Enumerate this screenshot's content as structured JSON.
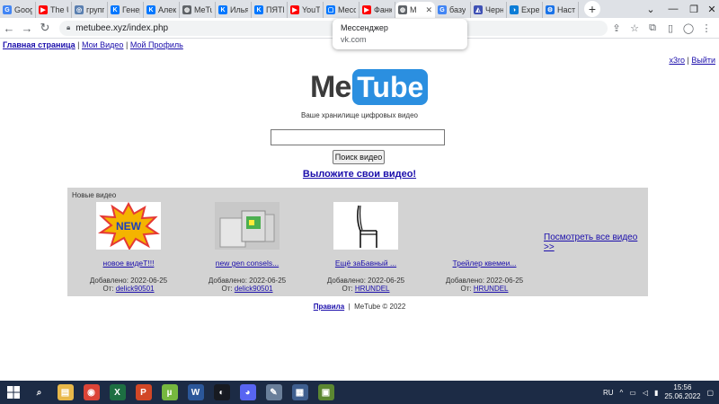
{
  "browser": {
    "tabs": [
      {
        "label": "Goog",
        "icon": "google-icon",
        "color": "#4285f4",
        "glyph": "G"
      },
      {
        "label": "The U",
        "icon": "youtube-icon",
        "color": "#ff0000",
        "glyph": "▶"
      },
      {
        "label": "групп",
        "icon": "vk-icon",
        "color": "#5a7fb0",
        "glyph": "◎"
      },
      {
        "label": "Генер",
        "icon": "vk-icon",
        "color": "#0077ff",
        "glyph": "K"
      },
      {
        "label": "Алек",
        "icon": "vk-icon",
        "color": "#0077ff",
        "glyph": "K"
      },
      {
        "label": "MeTu",
        "icon": "globe-icon",
        "color": "#5f6368",
        "glyph": "◍"
      },
      {
        "label": "Илья",
        "icon": "vk-icon",
        "color": "#0077ff",
        "glyph": "K"
      },
      {
        "label": "ПЯТЁ",
        "icon": "vk-icon",
        "color": "#0077ff",
        "glyph": "K"
      },
      {
        "label": "YouTu",
        "icon": "youtube-icon",
        "color": "#ff0000",
        "glyph": "▶"
      },
      {
        "label": "Месс",
        "icon": "messenger-icon",
        "color": "#0077ff",
        "glyph": "▢"
      },
      {
        "label": "Фанк",
        "icon": "youtube-icon",
        "color": "#ff0000",
        "glyph": "▶"
      },
      {
        "label": "M",
        "icon": "globe-icon",
        "color": "#5f6368",
        "glyph": "◍",
        "active": true
      },
      {
        "label": "базу",
        "icon": "google-icon",
        "color": "#4285f4",
        "glyph": "G"
      },
      {
        "label": "Черн",
        "icon": "chart-icon",
        "color": "#3f51b5",
        "glyph": "◭"
      },
      {
        "label": "Exper",
        "icon": "edge-icon",
        "color": "#0a7cd6",
        "glyph": "◑"
      },
      {
        "label": "Наст",
        "icon": "gear-icon",
        "color": "#1a73e8",
        "glyph": "⚙"
      }
    ],
    "new_tab": "+",
    "url": "metubee.xyz/index.php",
    "tooltip": {
      "title": "Мессенджер",
      "subtitle": "vk.com"
    }
  },
  "page": {
    "nav": {
      "home": "Главная страница",
      "my_videos": "Мои Видео",
      "my_profile": "Мой Профиль",
      "separator": "|"
    },
    "user": {
      "name": "x3ro",
      "logout": "Выйти",
      "separator": "|"
    },
    "logo": {
      "me": "Me",
      "tube": "Tube"
    },
    "tagline": "Ваше хранилище цифровых видео",
    "search": {
      "value": "",
      "placeholder": "",
      "button": "Поиск видео"
    },
    "upload_link": "Выложите свои видео!",
    "new_videos": {
      "caption": "Новые видео",
      "see_all": "Посмотреть все видео >>",
      "items": [
        {
          "title": "новое видеТ!!!",
          "date": "Добавлено: 2022-06-25",
          "by_label": "От:",
          "author": "delick90501"
        },
        {
          "title": "new gen consels...",
          "date": "Добавлено: 2022-06-25",
          "by_label": "От:",
          "author": "delick90501"
        },
        {
          "title": "Ещё заБавный ...",
          "date": "Добавлено: 2022-06-25",
          "by_label": "От:",
          "author": "HRUNDEL"
        },
        {
          "title": "Трейлер квемеи...",
          "date": "Добавлено: 2022-06-25",
          "by_label": "От:",
          "author": "HRUNDEL"
        }
      ]
    },
    "footer": {
      "rules": "Правила",
      "separator": "|",
      "copyright": "MeTube © 2022"
    }
  },
  "taskbar": {
    "apps": [
      {
        "name": "search-icon",
        "color": "#1c2b45",
        "glyph": "⌕"
      },
      {
        "name": "file-explorer-icon",
        "color": "#e8b84a",
        "glyph": "▤"
      },
      {
        "name": "chrome-icon",
        "color": "#db4437",
        "glyph": "◉"
      },
      {
        "name": "excel-icon",
        "color": "#1d6f42",
        "glyph": "X"
      },
      {
        "name": "powerpoint-icon",
        "color": "#d24726",
        "glyph": "P"
      },
      {
        "name": "utorrent-icon",
        "color": "#76b83f",
        "glyph": "µ"
      },
      {
        "name": "word-icon",
        "color": "#2b579a",
        "glyph": "W"
      },
      {
        "name": "steam-icon",
        "color": "#171a21",
        "glyph": "◐"
      },
      {
        "name": "discord-icon",
        "color": "#5865f2",
        "glyph": "◕"
      },
      {
        "name": "paint-icon",
        "color": "#6a7f9a",
        "glyph": "✎"
      },
      {
        "name": "presentation-app-icon",
        "color": "#3f5f8f",
        "glyph": "▦"
      },
      {
        "name": "minecraft-icon",
        "color": "#5b8731",
        "glyph": "▣"
      }
    ],
    "lang": "RU",
    "time": "15:56",
    "date": "25.06.2022"
  }
}
